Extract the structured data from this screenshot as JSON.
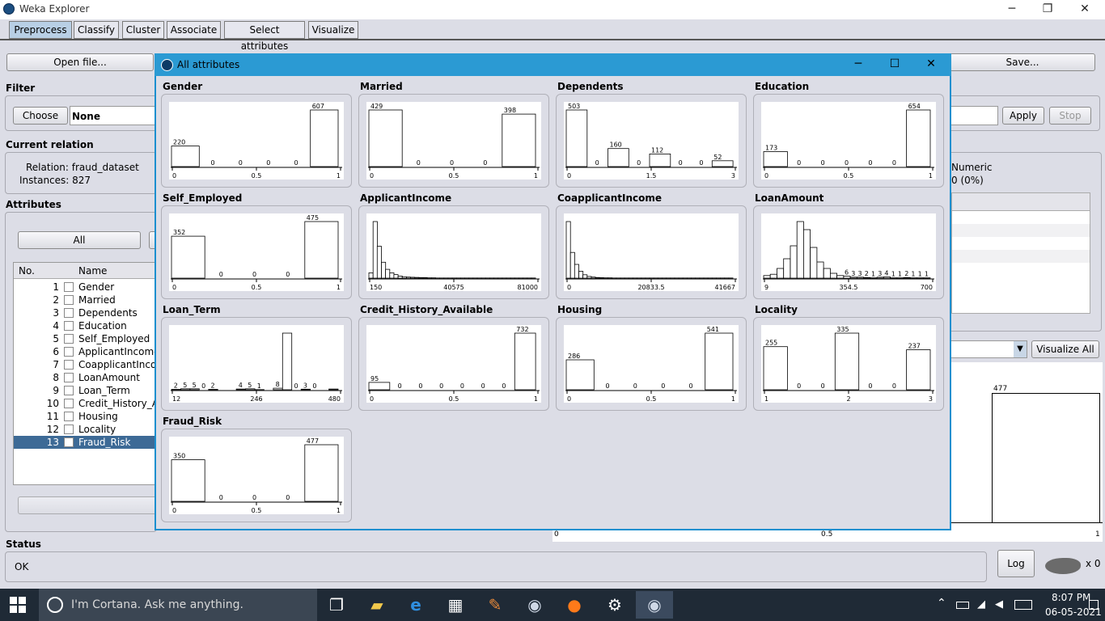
{
  "window": {
    "title": "Weka Explorer",
    "minimize": "─",
    "restore": "❐",
    "close": "✕"
  },
  "tabs": [
    "Preprocess",
    "Classify",
    "Cluster",
    "Associate",
    "Select attributes",
    "Visualize"
  ],
  "buttons": {
    "open_file": "Open file...",
    "save": "Save...",
    "choose": "Choose",
    "apply": "Apply",
    "stop": "Stop",
    "all": "All",
    "visualize_all": "Visualize All",
    "log": "Log"
  },
  "filter": {
    "label": "Filter",
    "value": "None"
  },
  "current_relation": {
    "label": "Current relation",
    "relation": "Relation: fraud_dataset",
    "instances": "Instances: 827"
  },
  "selected_attr": {
    "type": "Numeric",
    "missing": "0 (0%)"
  },
  "attributes": {
    "label": "Attributes",
    "col_no": "No.",
    "col_name": "Name",
    "items": [
      {
        "no": "1",
        "name": "Gender"
      },
      {
        "no": "2",
        "name": "Married"
      },
      {
        "no": "3",
        "name": "Dependents"
      },
      {
        "no": "4",
        "name": "Education"
      },
      {
        "no": "5",
        "name": "Self_Employed"
      },
      {
        "no": "6",
        "name": "ApplicantIncome"
      },
      {
        "no": "7",
        "name": "CoapplicantIncome"
      },
      {
        "no": "8",
        "name": "LoanAmount"
      },
      {
        "no": "9",
        "name": "Loan_Term"
      },
      {
        "no": "10",
        "name": "Credit_History_Available"
      },
      {
        "no": "11",
        "name": "Housing"
      },
      {
        "no": "12",
        "name": "Locality"
      },
      {
        "no": "13",
        "name": "Fraud_Risk"
      }
    ],
    "selected": "13"
  },
  "bg_histogram": {
    "bar_label": "477",
    "ticks": [
      "0",
      "0.5",
      "1"
    ]
  },
  "status": {
    "label": "Status",
    "text": "OK",
    "x_count": "x 0"
  },
  "dialog": {
    "title": "All attributes",
    "plots": [
      {
        "name": "Gender",
        "bars": [
          220,
          0,
          0,
          0,
          0,
          607
        ],
        "labels": [
          "220",
          "0",
          "0",
          "0",
          "0",
          "607"
        ],
        "ticks": [
          "0",
          "0.5",
          "1"
        ]
      },
      {
        "name": "Married",
        "bars": [
          429,
          0,
          0,
          0,
          398
        ],
        "labels": [
          "429",
          "0",
          "0",
          "0",
          "398"
        ],
        "ticks": [
          "0",
          "0.5",
          "1"
        ]
      },
      {
        "name": "Dependents",
        "bars": [
          503,
          0,
          160,
          0,
          112,
          0,
          0,
          52
        ],
        "labels": [
          "503",
          "0",
          "160",
          "0",
          "112",
          "0",
          "0",
          "52"
        ],
        "ticks": [
          "0",
          "1.5",
          "3"
        ]
      },
      {
        "name": "Education",
        "bars": [
          173,
          0,
          0,
          0,
          0,
          0,
          654
        ],
        "labels": [
          "173",
          "0",
          "0",
          "0",
          "0",
          "0",
          "654"
        ],
        "ticks": [
          "0",
          "0.5",
          "1"
        ]
      },
      {
        "name": "Self_Employed",
        "bars": [
          352,
          0,
          0,
          0,
          475
        ],
        "labels": [
          "352",
          "0",
          "0",
          "0",
          "475"
        ],
        "ticks": [
          "0",
          "0.5",
          "1"
        ]
      },
      {
        "name": "ApplicantIncome",
        "bars": [
          30,
          320,
          180,
          90,
          50,
          30,
          20,
          12,
          8,
          6,
          5,
          4,
          3,
          3,
          2,
          2,
          1,
          1,
          1,
          1,
          1,
          1,
          1,
          1,
          1,
          1,
          1,
          1,
          1,
          1,
          1,
          1,
          1,
          1,
          1,
          1,
          1,
          1,
          1,
          1
        ],
        "labels": [],
        "ticks": [
          "150",
          "40575",
          "81000"
        ]
      },
      {
        "name": "CoapplicantIncome",
        "bars": [
          330,
          150,
          80,
          40,
          20,
          10,
          6,
          4,
          3,
          2,
          2,
          1,
          1,
          1,
          1,
          1,
          1,
          1,
          1,
          1,
          1,
          1,
          1,
          1,
          1,
          1,
          1,
          1,
          1,
          1,
          1,
          1,
          1,
          1,
          1,
          1,
          1,
          1,
          1,
          1
        ],
        "labels": [],
        "ticks": [
          "0",
          "20833.5",
          "41667"
        ]
      },
      {
        "name": "LoanAmount",
        "bars": [
          8,
          12,
          30,
          60,
          100,
          175,
          150,
          95,
          50,
          30,
          15,
          8,
          6,
          3,
          3,
          2,
          1,
          3,
          4,
          1,
          1,
          2,
          1,
          1,
          1
        ],
        "labels": [
          "",
          "",
          "",
          "",
          "",
          "",
          "",
          "",
          "",
          "",
          "",
          "",
          "6",
          "3",
          "3",
          "2",
          "1",
          "3",
          "4",
          "1",
          "1",
          "2",
          "1",
          "1",
          "1"
        ],
        "ticks": [
          "9",
          "354.5",
          "700"
        ]
      },
      {
        "name": "Loan_Term",
        "bars": [
          2,
          5,
          5,
          0,
          2,
          0,
          0,
          4,
          5,
          1,
          0,
          8,
          300,
          0,
          3,
          0,
          0,
          4
        ],
        "labels": [
          "2",
          "5",
          "5",
          "0",
          "2",
          "",
          "",
          "4",
          "5",
          "1",
          "",
          "8",
          "",
          "0",
          "3",
          "0",
          "",
          ""
        ],
        "ticks": [
          "12",
          "246",
          "480"
        ]
      },
      {
        "name": "Credit_History_Available",
        "bars": [
          95,
          0,
          0,
          0,
          0,
          0,
          0,
          732
        ],
        "labels": [
          "95",
          "0",
          "0",
          "0",
          "0",
          "0",
          "0",
          "732"
        ],
        "ticks": [
          "0",
          "0.5",
          "1"
        ]
      },
      {
        "name": "Housing",
        "bars": [
          286,
          0,
          0,
          0,
          0,
          541
        ],
        "labels": [
          "286",
          "0",
          "0",
          "0",
          "0",
          "541"
        ],
        "ticks": [
          "0",
          "0.5",
          "1"
        ]
      },
      {
        "name": "Locality",
        "bars": [
          255,
          0,
          0,
          335,
          0,
          0,
          237
        ],
        "labels": [
          "255",
          "0",
          "0",
          "335",
          "0",
          "0",
          "237"
        ],
        "ticks": [
          "1",
          "2",
          "3"
        ]
      },
      {
        "name": "Fraud_Risk",
        "bars": [
          350,
          0,
          0,
          0,
          477
        ],
        "labels": [
          "350",
          "0",
          "0",
          "0",
          "477"
        ],
        "ticks": [
          "0",
          "0.5",
          "1"
        ]
      }
    ]
  },
  "taskbar": {
    "search": "I'm Cortana. Ask me anything.",
    "time": "8:07 PM",
    "date": "06-05-2021"
  }
}
